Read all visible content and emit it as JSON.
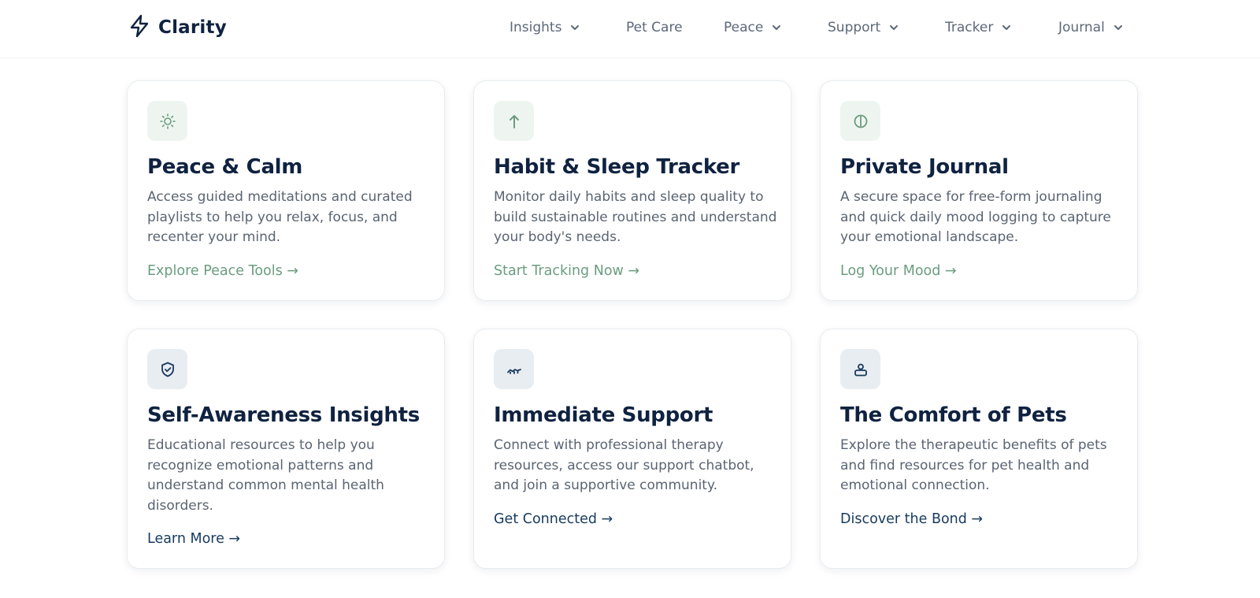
{
  "header": {
    "brand": "Clarity",
    "nav": [
      {
        "label": "Insights",
        "has_dropdown": true
      },
      {
        "label": "Pet Care",
        "has_dropdown": false
      },
      {
        "label": "Peace",
        "has_dropdown": true
      },
      {
        "label": "Support",
        "has_dropdown": true
      },
      {
        "label": "Tracker",
        "has_dropdown": true
      },
      {
        "label": "Journal",
        "has_dropdown": true
      }
    ]
  },
  "cards": [
    {
      "icon": "sun-icon",
      "title": "Peace & Calm",
      "description": "Access guided meditations and curated playlists to help you relax, focus, and recenter your mind.",
      "link": "Explore Peace Tools →"
    },
    {
      "icon": "arrow-up-icon",
      "title": "Habit & Sleep Tracker",
      "description": "Monitor daily habits and sleep quality to build sustainable routines and understand your body's needs.",
      "link": "Start Tracking Now →"
    },
    {
      "icon": "journal-icon",
      "title": "Private Journal",
      "description": "A secure space for free-form journaling and quick daily mood logging to capture your emotional landscape.",
      "link": "Log Your Mood →"
    },
    {
      "icon": "shield-check-icon",
      "title": "Self-Awareness Insights",
      "description": "Educational resources to help you recognize emotional patterns and understand common mental health disorders.",
      "link": "Learn More →"
    },
    {
      "icon": "handshake-icon",
      "title": "Immediate Support",
      "description": "Connect with professional therapy resources, access our support chatbot, and join a supportive community.",
      "link": "Get Connected →"
    },
    {
      "icon": "pet-carrier-icon",
      "title": "The Comfort of Pets",
      "description": "Explore the therapeutic benefits of pets and find resources for pet health and emotional connection.",
      "link": "Discover the Bond →"
    }
  ],
  "colors": {
    "navy": "#0f2240",
    "accent_green": "#6a9d7e",
    "link_navy": "#173a5e",
    "icon_bg_green": "#eef5f1",
    "icon_bg_blue": "#e8edf2"
  }
}
